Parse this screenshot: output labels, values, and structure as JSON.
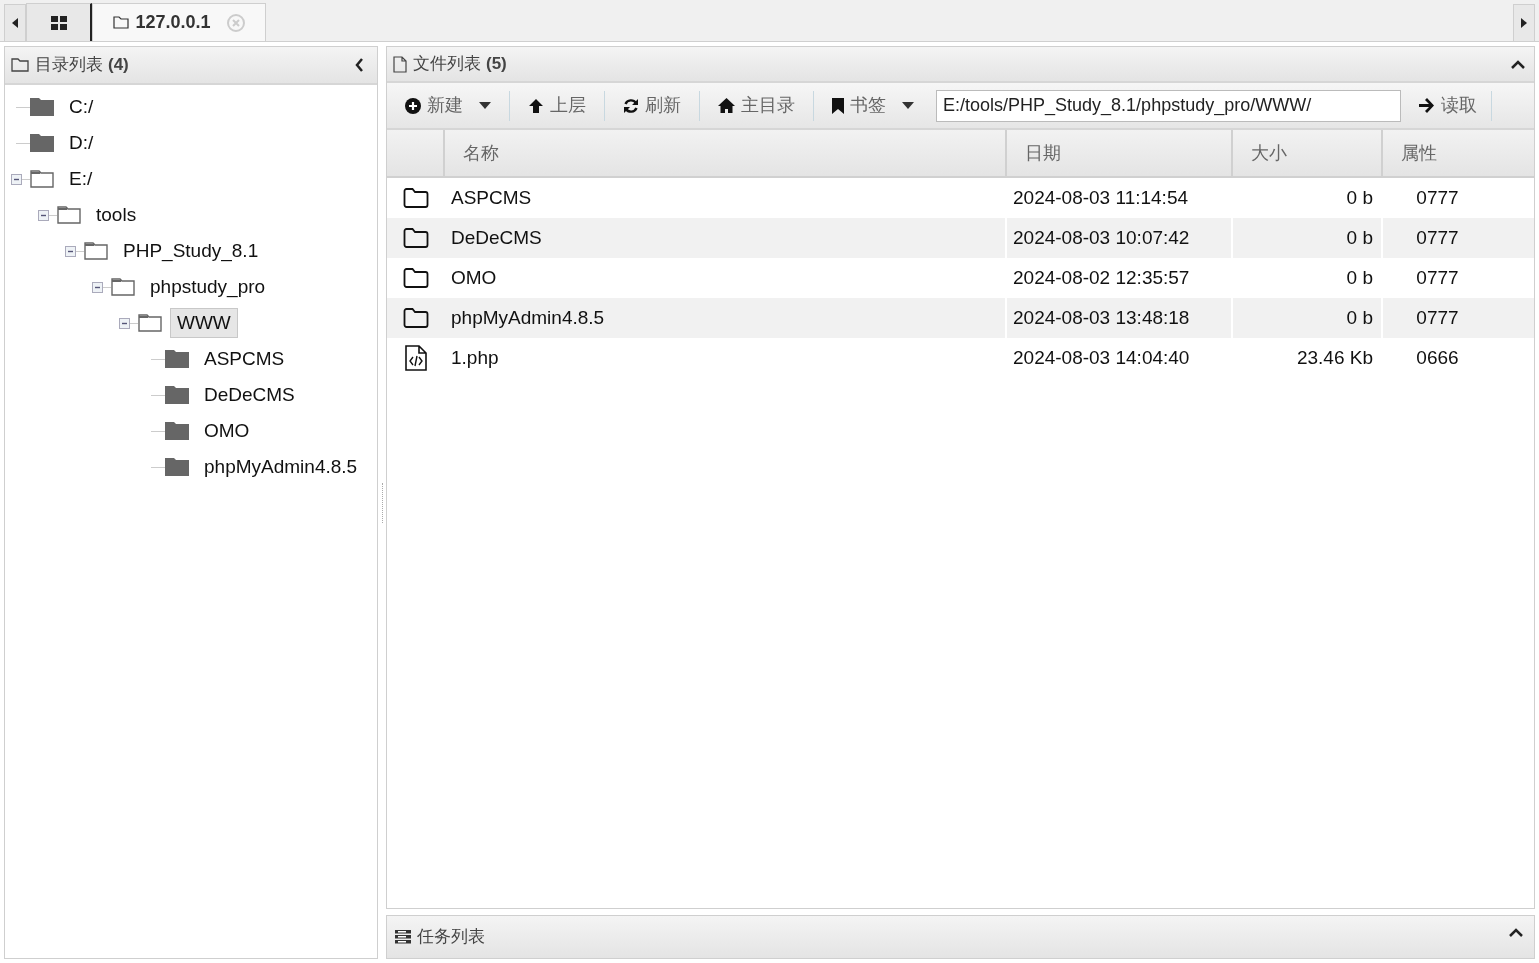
{
  "tabs": [
    {
      "kind": "home",
      "selected": false
    },
    {
      "kind": "site",
      "label": "127.0.0.1",
      "selected": true
    }
  ],
  "dir_panel": {
    "title": "目录列表",
    "count": "(4)"
  },
  "tree": [
    {
      "label": "C:/",
      "expanded": false,
      "selected": false
    },
    {
      "label": "D:/",
      "expanded": false,
      "selected": false
    },
    {
      "label": "E:/",
      "expanded": true,
      "selected": false,
      "children": [
        {
          "label": "tools",
          "expanded": true,
          "selected": false,
          "children": [
            {
              "label": "PHP_Study_8.1",
              "expanded": true,
              "selected": false,
              "children": [
                {
                  "label": "phpstudy_pro",
                  "expanded": true,
                  "selected": false,
                  "children": [
                    {
                      "label": "WWW",
                      "expanded": true,
                      "selected": true,
                      "children": [
                        {
                          "label": "ASPCMS",
                          "expanded": false,
                          "selected": false
                        },
                        {
                          "label": "DeDeCMS",
                          "expanded": false,
                          "selected": false
                        },
                        {
                          "label": "OMO",
                          "expanded": false,
                          "selected": false
                        },
                        {
                          "label": "phpMyAdmin4.8.5",
                          "expanded": false,
                          "selected": false
                        }
                      ]
                    }
                  ]
                }
              ]
            }
          ]
        }
      ]
    }
  ],
  "file_panel": {
    "title": "文件列表",
    "count": "(5)"
  },
  "toolbar": [
    {
      "kind": "new",
      "label": "新建",
      "dropdown": true
    },
    {
      "kind": "up",
      "label": "上层",
      "dropdown": false
    },
    {
      "kind": "refresh",
      "label": "刷新",
      "dropdown": false
    },
    {
      "kind": "home",
      "label": "主目录",
      "dropdown": false
    },
    {
      "kind": "bookmark",
      "label": "书签",
      "dropdown": true
    }
  ],
  "path_field": {
    "value": "E:/tools/PHP_Study_8.1/phpstudy_pro/WWW/"
  },
  "read_button": {
    "label": "读取"
  },
  "table": {
    "columns": [
      "名称",
      "日期",
      "大小",
      "属性"
    ],
    "rows": [
      {
        "kind": "folder",
        "name": "ASPCMS",
        "date": "2024-08-03 11:14:54",
        "size": "0 b",
        "perm": "0777"
      },
      {
        "kind": "folder",
        "name": "DeDeCMS",
        "date": "2024-08-03 10:07:42",
        "size": "0 b",
        "perm": "0777"
      },
      {
        "kind": "folder",
        "name": "OMO",
        "date": "2024-08-02 12:35:57",
        "size": "0 b",
        "perm": "0777"
      },
      {
        "kind": "folder",
        "name": "phpMyAdmin4.8.5",
        "date": "2024-08-03 13:48:18",
        "size": "0 b",
        "perm": "0777"
      },
      {
        "kind": "file",
        "name": "1.php",
        "date": "2024-08-03 14:04:40",
        "size": "23.46 Kb",
        "perm": "0666"
      }
    ]
  },
  "task_panel": {
    "title": "任务列表"
  }
}
